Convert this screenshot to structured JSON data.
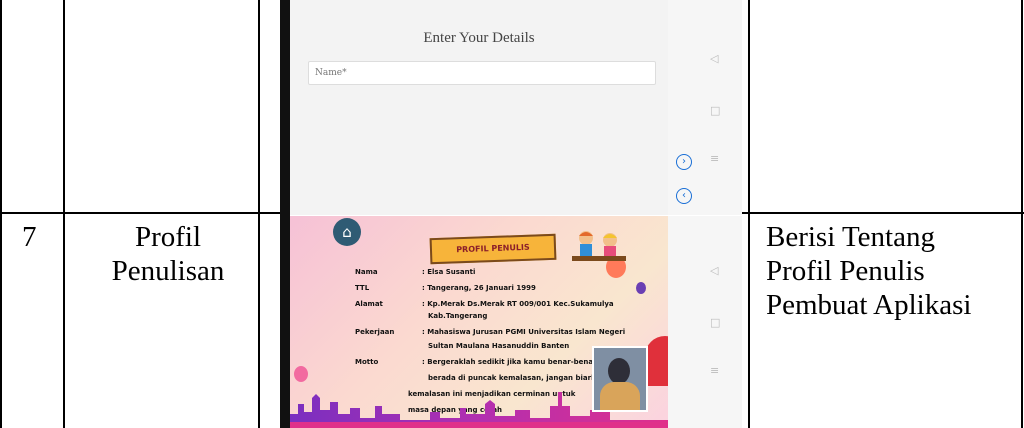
{
  "row1": {
    "screenshot_title": "Enter Your Details",
    "name_placeholder": "Name*"
  },
  "row2": {
    "number": "7",
    "title_line1": "Profil",
    "title_line2": "Penulisan",
    "desc_line1": "Berisi Tentang",
    "desc_line2": "Profil Penulis",
    "desc_line3": "Pembuat Aplikasi",
    "banner": "PROFIL PENULIS",
    "profile": {
      "nama_label": "Nama",
      "nama_value": ": Elsa Susanti",
      "ttl_label": "TTL",
      "ttl_value": ": Tangerang, 26 Januari 1999",
      "alamat_label": "Alamat",
      "alamat_value1": ": Kp.Merak Ds.Merak RT 009/001 Kec.Sukamulya",
      "alamat_value2": "Kab.Tangerang",
      "pekerjaan_label": "Pekerjaan",
      "pekerjaan_value1": ": Mahasiswa Jurusan PGMI Universitas Islam Negeri",
      "pekerjaan_value2": "Sultan Maulana Hasanuddin Banten",
      "motto_label": "Motto",
      "motto_value1": ": Bergeraklah sedikit jika kamu benar-benar",
      "motto_value2": "berada di puncak kemalasan, jangan biarkan",
      "motto_value3": "kemalasan ini menjadikan cerminan untuk",
      "motto_value4": "masa depan yang cerah"
    }
  },
  "icons": {
    "back": "◁",
    "home": "□",
    "menu": "≡",
    "next": "›",
    "prev": "‹",
    "house": "⌂"
  }
}
